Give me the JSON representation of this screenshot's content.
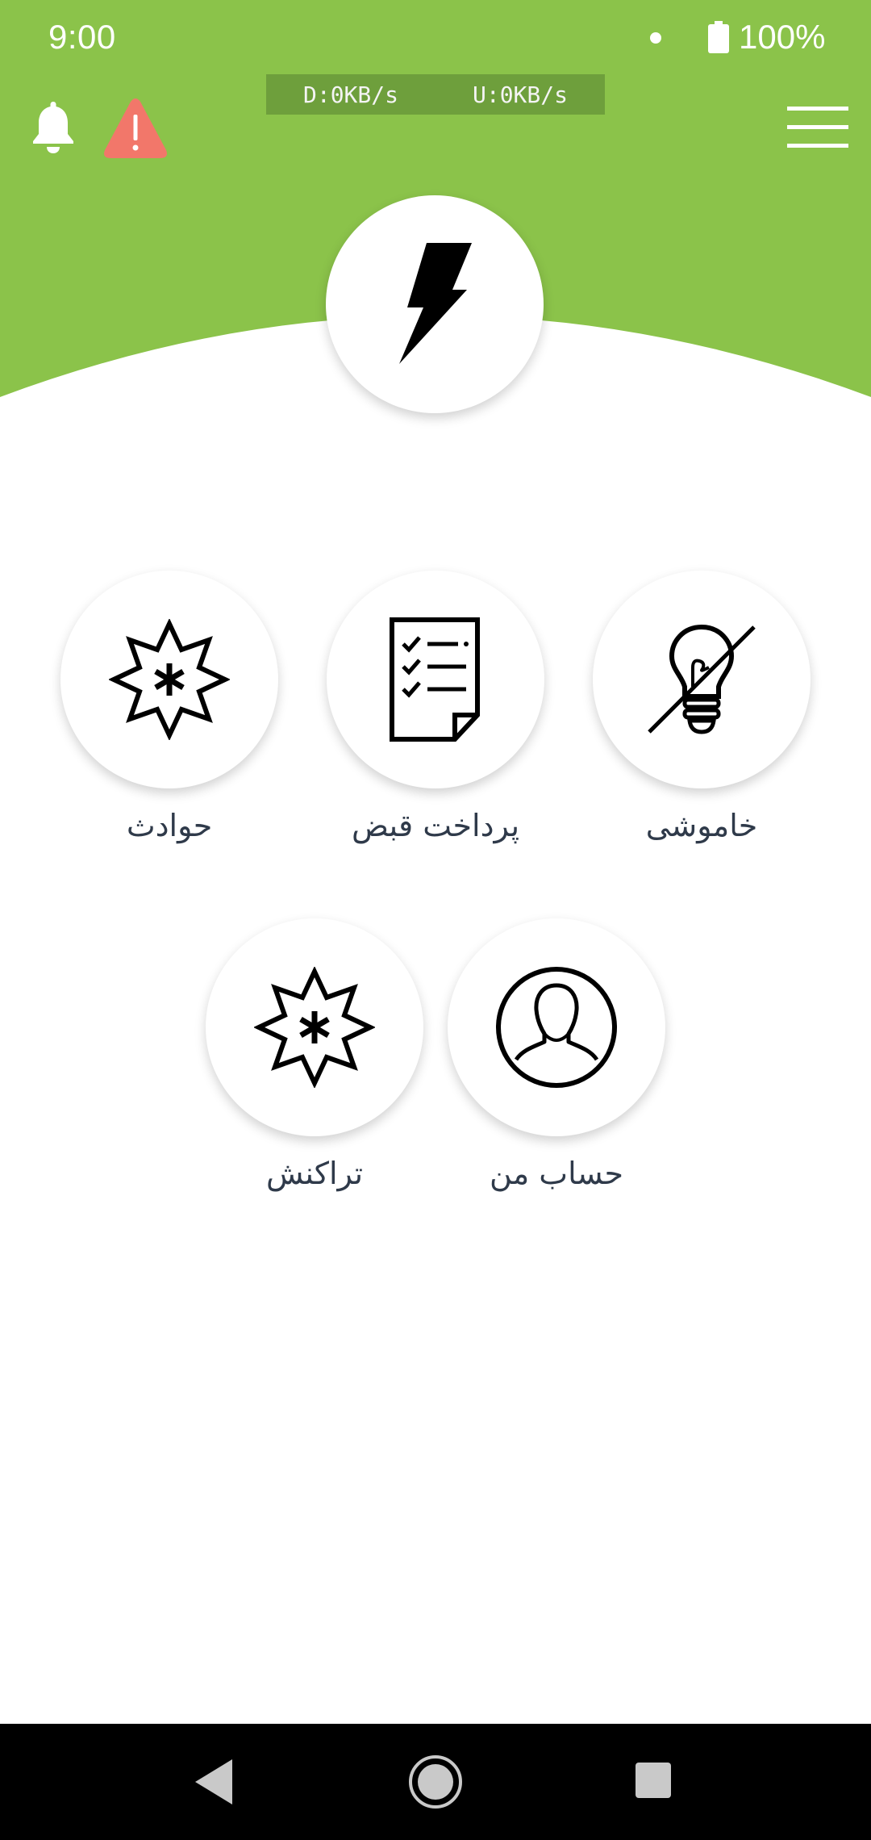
{
  "status_bar": {
    "time": "9:00",
    "battery": "100%"
  },
  "network": {
    "download": "D:0KB/s",
    "upload": "U:0KB/s"
  },
  "colors": {
    "header_green": "#8bc34a",
    "alert_red": "#f2776a",
    "label_text": "#2f3a4a"
  },
  "header": {
    "notification_icon": "bell-icon",
    "alert_icon": "warning-icon",
    "menu_icon": "hamburger-menu-icon",
    "main_icon": "lightning-bolt-icon"
  },
  "tiles": [
    {
      "label": "حوادث",
      "icon": "incident-star-icon"
    },
    {
      "label": "پرداخت قبض",
      "icon": "bill-checklist-icon"
    },
    {
      "label": "خاموشی",
      "icon": "power-outage-bulb-icon"
    },
    {
      "label": "تراکنش",
      "icon": "transaction-star-icon"
    },
    {
      "label": "حساب من",
      "icon": "user-account-icon"
    }
  ],
  "nav_bar": {
    "back_icon": "back-triangle-icon",
    "home_icon": "home-circle-icon",
    "recent_icon": "recent-square-icon"
  }
}
